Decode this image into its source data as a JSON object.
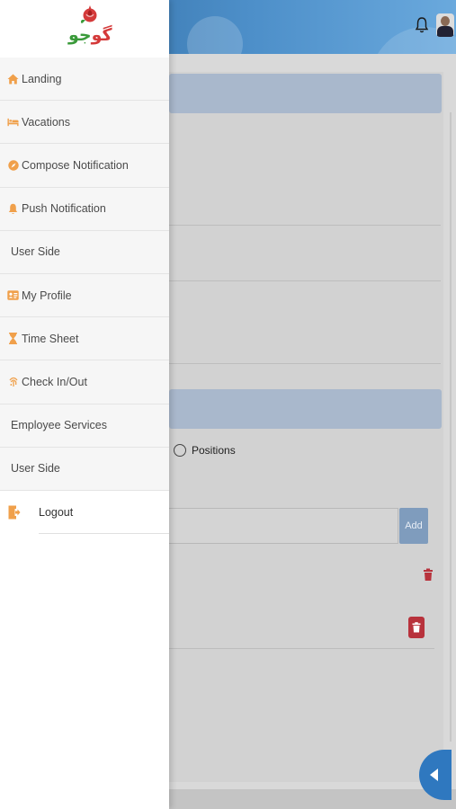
{
  "header": {
    "notification_icon": "bell-icon",
    "avatar_icon": "user-avatar"
  },
  "logo": {
    "text_part1": "گو",
    "text_part2": "جو",
    "icon": "rose-logo"
  },
  "drawer": {
    "items": [
      {
        "label": "Landing",
        "icon": "home-icon"
      },
      {
        "label": "Vacations",
        "icon": "bed-icon"
      },
      {
        "label": "Compose Notification",
        "icon": "compass-icon"
      },
      {
        "label": "Push Notification",
        "icon": "bell-icon"
      },
      {
        "label": "User Side",
        "icon": ""
      },
      {
        "label": "My Profile",
        "icon": "id-card-icon"
      },
      {
        "label": "Time Sheet",
        "icon": "hourglass-icon"
      },
      {
        "label": "Check In/Out",
        "icon": "fingerprint-icon"
      },
      {
        "label": "Employee Services",
        "icon": ""
      },
      {
        "label": "User Side",
        "icon": ""
      }
    ],
    "logout_label": "Logout",
    "logout_icon": "sign-out-icon"
  },
  "background": {
    "radio_label": "Positions",
    "add_button_label": "Add",
    "delete_icon": "trash-icon",
    "collapse_icon": "caret-left-icon"
  },
  "colors": {
    "accent_orange": "#f0a04b",
    "header_blue": "#3f7fbf",
    "delete_red": "#c0392b",
    "fab_blue": "#2f78bf"
  }
}
